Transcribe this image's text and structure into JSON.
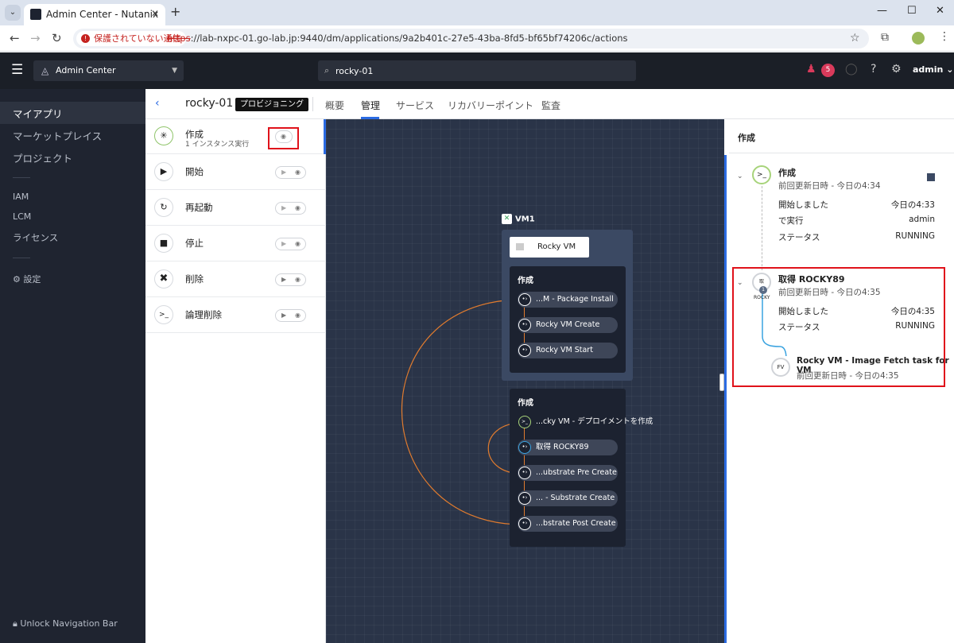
{
  "browser": {
    "tab_title": "Admin Center - Nutanix",
    "security_warning": "保護されていない通信",
    "url_scheme": "https",
    "url_rest": "://lab-nxpc-01.go-lab.jp:9440/dm/applications/9a2b401c-27e5-43ba-8fd5-bf65bf74206c/actions"
  },
  "header": {
    "app_selector": "Admin Center",
    "search_value": "rocky-01",
    "alert_count": "5",
    "user": "admin"
  },
  "leftnav": {
    "items": [
      "マイアプリ",
      "マーケットプレイス",
      "プロジェクト"
    ],
    "items2": [
      "IAM",
      "LCM",
      "ライセンス"
    ],
    "settings": "設定",
    "unlock": "Unlock Navigation Bar"
  },
  "app": {
    "name": "rocky-01",
    "state": "プロビジョニング",
    "tabs": [
      "概要",
      "管理",
      "サービス",
      "リカバリーポイント",
      "監査"
    ],
    "active_tab": "管理"
  },
  "actions": [
    {
      "label": "作成",
      "sub": "1 インスタンス実行",
      "icon": "create-icon"
    },
    {
      "label": "開始",
      "sub": "",
      "icon": "play-icon"
    },
    {
      "label": "再起動",
      "sub": "",
      "icon": "restart-icon"
    },
    {
      "label": "停止",
      "sub": "",
      "icon": "stop-icon"
    },
    {
      "label": "削除",
      "sub": "",
      "icon": "delete-icon"
    },
    {
      "label": "論理削除",
      "sub": "",
      "icon": "terminal-icon"
    }
  ],
  "canvas": {
    "service": "VM1",
    "substrate": "Rocky VM",
    "panel1": {
      "title": "作成",
      "tasks": [
        "...M - Package Install",
        "Rocky VM Create",
        "Rocky VM Start"
      ]
    },
    "panel2": {
      "title": "作成",
      "tasks": [
        "...cky VM - デプロイメントを作成",
        "取得 ROCKY89",
        "...ubstrate Pre Create",
        "... - Substrate Create",
        "...bstrate Post Create"
      ]
    }
  },
  "runlog": {
    "title": "作成",
    "entry1": {
      "title": "作成",
      "updated": "前回更新日時 - 今日の4:34",
      "rows": [
        {
          "label": "開始しました",
          "value": "今日の4:33"
        },
        {
          "label": "で実行",
          "value": "admin"
        },
        {
          "label": "ステータス",
          "value": "RUNNING"
        }
      ]
    },
    "entry2": {
      "icon_text": "取ROCKY",
      "count": "1",
      "title": "取得 ROCKY89",
      "updated": "前回更新日時 - 今日の4:35",
      "rows": [
        {
          "label": "開始しました",
          "value": "今日の4:35"
        },
        {
          "label": "ステータス",
          "value": "RUNNING"
        }
      ],
      "child": {
        "icon": "FV",
        "title": "Rocky VM - Image Fetch task for VM",
        "updated": "前回更新日時 - 今日の4:35"
      }
    }
  }
}
